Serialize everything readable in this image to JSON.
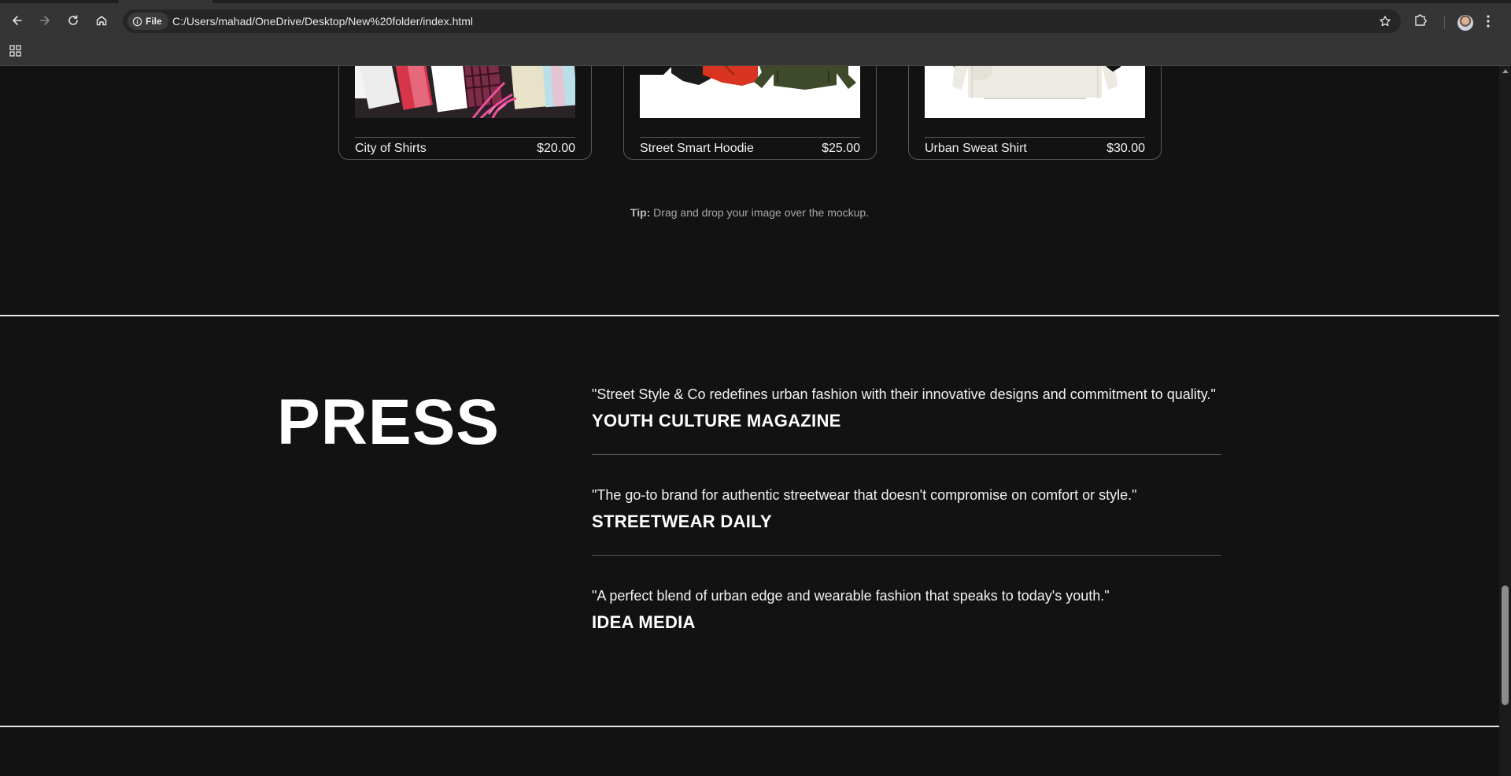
{
  "browser": {
    "file_chip_label": "File",
    "url": "C:/Users/mahad/OneDrive/Desktop/New%20folder/index.html"
  },
  "products": [
    {
      "name": "City of Shirts",
      "price": "$20.00"
    },
    {
      "name": "Street Smart Hoodie",
      "price": "$25.00"
    },
    {
      "name": "Urban Sweat Shirt",
      "price": "$30.00"
    }
  ],
  "tip": {
    "label": "Tip:",
    "text": " Drag and drop your image over the mockup."
  },
  "press": {
    "title": "PRESS",
    "items": [
      {
        "quote": "\"Street Style & Co redefines urban fashion with their innovative designs and commitment to quality.\"",
        "source": "YOUTH CULTURE MAGAZINE"
      },
      {
        "quote": "\"The go-to brand for authentic streetwear that doesn't compromise on comfort or style.\"",
        "source": "STREETWEAR DAILY"
      },
      {
        "quote": "\"A perfect blend of urban edge and wearable fashion that speaks to today's youth.\"",
        "source": "IDEA MEDIA"
      }
    ]
  },
  "colors": {
    "page_background": "#121212",
    "browser_chrome": "#353535",
    "text_primary": "#ffffff",
    "tip_text": "#a8a8a8"
  },
  "icons": [
    "back-icon",
    "forward-icon",
    "reload-icon",
    "home-icon",
    "info-icon",
    "star-icon",
    "extensions-icon",
    "profile-avatar",
    "menu-icon",
    "apps-grid-icon"
  ]
}
